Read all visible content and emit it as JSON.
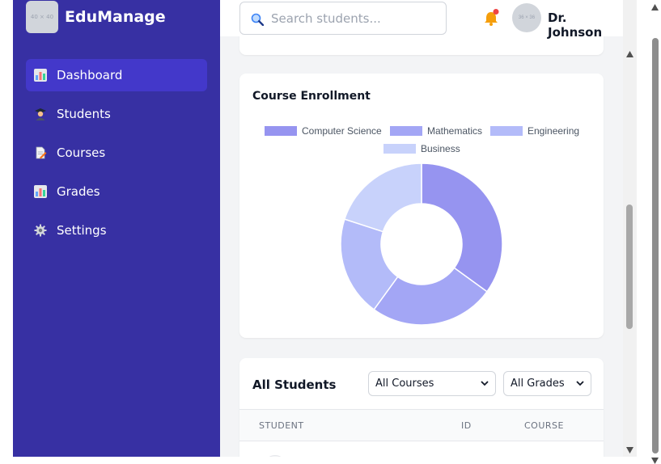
{
  "app": {
    "logo_placeholder": "40 × 40",
    "name": "EduManage"
  },
  "sidebar": {
    "items": [
      {
        "label": "Dashboard",
        "icon": "bar-chart-icon",
        "active": true
      },
      {
        "label": "Students",
        "icon": "student-icon",
        "active": false
      },
      {
        "label": "Courses",
        "icon": "document-icon",
        "active": false
      },
      {
        "label": "Grades",
        "icon": "bar-chart-icon",
        "active": false
      },
      {
        "label": "Settings",
        "icon": "gear-icon",
        "active": false
      }
    ]
  },
  "header": {
    "search_placeholder": "Search students...",
    "avatar_placeholder": "36 × 36",
    "user_name": "Dr. Johnson",
    "notification_dot": true
  },
  "enrollment_card": {
    "title": "Course Enrollment"
  },
  "chart_data": {
    "type": "pie",
    "title": "Course Enrollment",
    "donut": true,
    "legend_position": "top",
    "categories": [
      "Computer Science",
      "Mathematics",
      "Engineering",
      "Business"
    ],
    "values": [
      35,
      25,
      20,
      20
    ],
    "colors": [
      "#9694f0",
      "#a3a6f5",
      "#b3bbf9",
      "#c8d2fb"
    ]
  },
  "students_card": {
    "title": "All Students",
    "course_filter": {
      "selected": "All Courses",
      "options": [
        "All Courses"
      ]
    },
    "grade_filter": {
      "selected": "All Grades",
      "options": [
        "All Grades"
      ]
    },
    "columns": [
      "STUDENT",
      "ID",
      "COURSE"
    ]
  },
  "colors": {
    "sidebar_bg": "#3730a3",
    "sidebar_active": "#4338ca",
    "notification": "#ef4444",
    "bell": "#f59e0b"
  }
}
